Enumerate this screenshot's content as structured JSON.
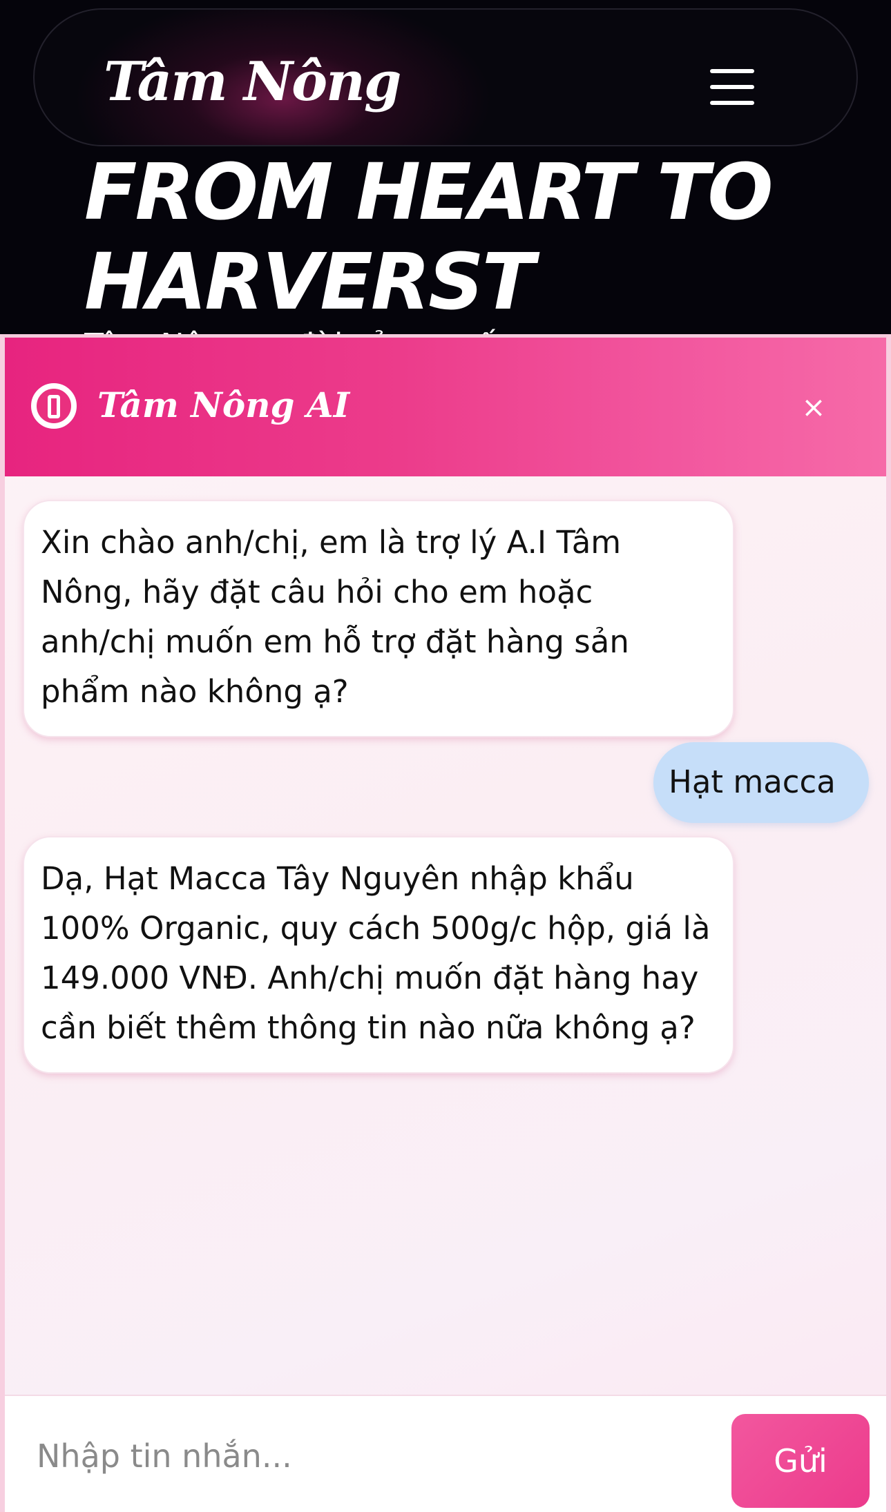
{
  "site": {
    "brand": "Tâm Nông",
    "hero_title": "FROM HEART TO HARVERST",
    "hero_subtitle_partial": "Tâm Nông ... đời sản ... sống ..."
  },
  "chat": {
    "title": "Tâm Nông AI",
    "close_label": "×",
    "messages": [
      {
        "role": "bot",
        "text": "Xin chào anh/chị, em là trợ lý A.I Tâm Nông, hãy đặt câu hỏi cho em hoặc anh/chị muốn em hỗ trợ đặt hàng sản phẩm nào không ạ?"
      },
      {
        "role": "user",
        "text": "Hạt macca"
      },
      {
        "role": "bot",
        "text": "Dạ, Hạt Macca Tây Nguyên nhập khẩu 100% Organic, quy cách 500g/c hộp, giá là 149.000 VNĐ. Anh/chị muốn đặt hàng hay cần biết thêm thông tin nào nữa không ạ?"
      }
    ],
    "input": {
      "placeholder": "Nhập tin nhắn...",
      "value": ""
    },
    "send_label": "Gửi"
  },
  "colors": {
    "header_gradient_start": "#e7247f",
    "header_gradient_end": "#f66aa8",
    "user_bubble": "#c6def9",
    "bot_bubble": "#ffffff",
    "site_background": "#05040b"
  },
  "icons": {
    "menu": "hamburger-menu-icon",
    "header": "alert-icon",
    "close": "close-icon"
  }
}
